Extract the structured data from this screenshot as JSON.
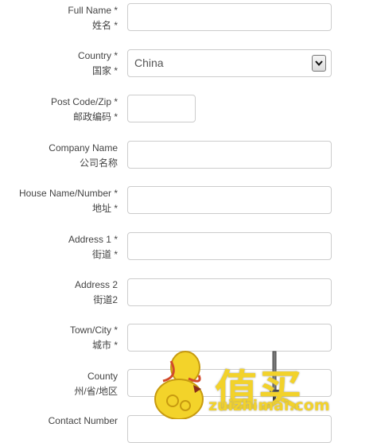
{
  "form": {
    "full_name": {
      "label_en": "Full Name *",
      "label_cn": "姓名 *",
      "value": ""
    },
    "country": {
      "label_en": "Country *",
      "label_cn": "国家 *",
      "value": "China"
    },
    "postcode": {
      "label_en": "Post Code/Zip *",
      "label_cn": "邮政编码 *",
      "value": ""
    },
    "company": {
      "label_en": "Company Name",
      "label_cn": "公司名称",
      "value": ""
    },
    "house": {
      "label_en": "House Name/Number *",
      "label_cn": "地址 *",
      "value": ""
    },
    "address1": {
      "label_en": "Address 1 *",
      "label_cn": "街道 *",
      "value": ""
    },
    "address2": {
      "label_en": "Address 2",
      "label_cn": "街道2",
      "value": ""
    },
    "town": {
      "label_en": "Town/City *",
      "label_cn": "城市 *",
      "value": ""
    },
    "county": {
      "label_en": "County",
      "label_cn": "州/省/地区",
      "value": ""
    },
    "contact": {
      "label_en": "Contact Number",
      "value": ""
    }
  },
  "watermark": {
    "brand": "值买",
    "url": "zuizhimai.com"
  }
}
